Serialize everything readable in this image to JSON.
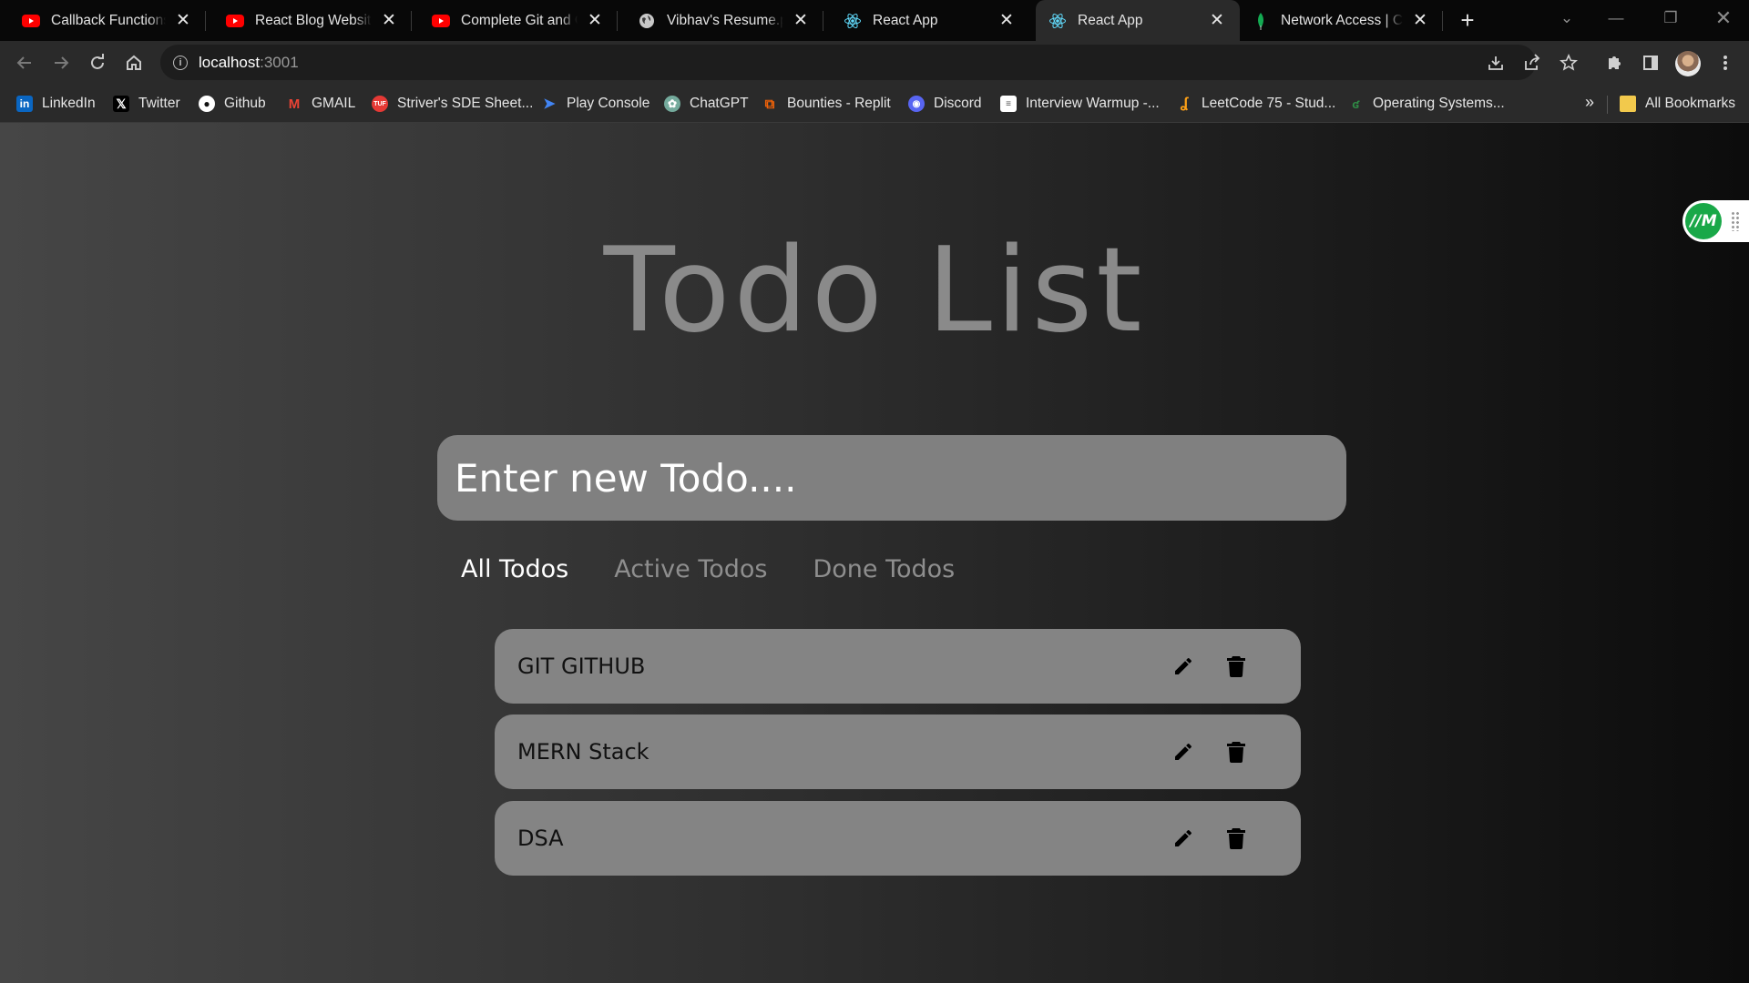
{
  "tabs": [
    {
      "title": "Callback Functions in JavaScript",
      "icon": "youtube-icon",
      "active": false
    },
    {
      "title": "React Blog Website Design",
      "icon": "youtube-icon",
      "active": false
    },
    {
      "title": "Complete Git and GitHub",
      "icon": "youtube-icon",
      "active": false
    },
    {
      "title": "Vibhav's Resume.pdf",
      "icon": "globe-icon",
      "active": false
    },
    {
      "title": "React App",
      "icon": "react-icon",
      "active": false
    },
    {
      "title": "React App",
      "icon": "react-icon",
      "active": true
    },
    {
      "title": "Network Access | Cloud",
      "icon": "mongodb-leaf-icon",
      "active": false
    }
  ],
  "address": {
    "host": "localhost",
    "port": ":3001"
  },
  "bookmarks": [
    {
      "label": "LinkedIn",
      "icon": "linkedin-icon",
      "color": "#0a66c2"
    },
    {
      "label": "Twitter",
      "icon": "x-icon",
      "color": "#000000"
    },
    {
      "label": "Github",
      "icon": "github-icon",
      "color": "#ffffff"
    },
    {
      "label": "GMAIL",
      "icon": "gmail-icon",
      "color": "#ea4335"
    },
    {
      "label": "Striver's SDE Sheet...",
      "icon": "tuf-icon",
      "color": "#e53935"
    },
    {
      "label": "Play Console",
      "icon": "play-console-icon",
      "color": "#4285f4"
    },
    {
      "label": "ChatGPT",
      "icon": "chatgpt-icon",
      "color": "#74aa9c"
    },
    {
      "label": "Bounties - Replit",
      "icon": "replit-icon",
      "color": "#f26207"
    },
    {
      "label": "Discord",
      "icon": "discord-icon",
      "color": "#5865f2"
    },
    {
      "label": "Interview Warmup -...",
      "icon": "google-doc-icon",
      "color": "#ffffff"
    },
    {
      "label": "LeetCode 75 - Stud...",
      "icon": "leetcode-icon",
      "color": "#ffa116"
    },
    {
      "label": "Operating Systems...",
      "icon": "geeks-icon",
      "color": "#2f8d46"
    }
  ],
  "bookmarks_more": "»",
  "all_bookmarks": "All Bookmarks",
  "app": {
    "title": "Todo List",
    "input_placeholder": "Enter new Todo....",
    "filters": [
      "All Todos",
      "Active Todos",
      "Done Todos"
    ],
    "active_filter": "All Todos",
    "todos": [
      "GIT GITHUB",
      "MERN Stack",
      "DSA"
    ]
  },
  "extension_badge": {
    "label": "//M",
    "color": "#19a848"
  }
}
